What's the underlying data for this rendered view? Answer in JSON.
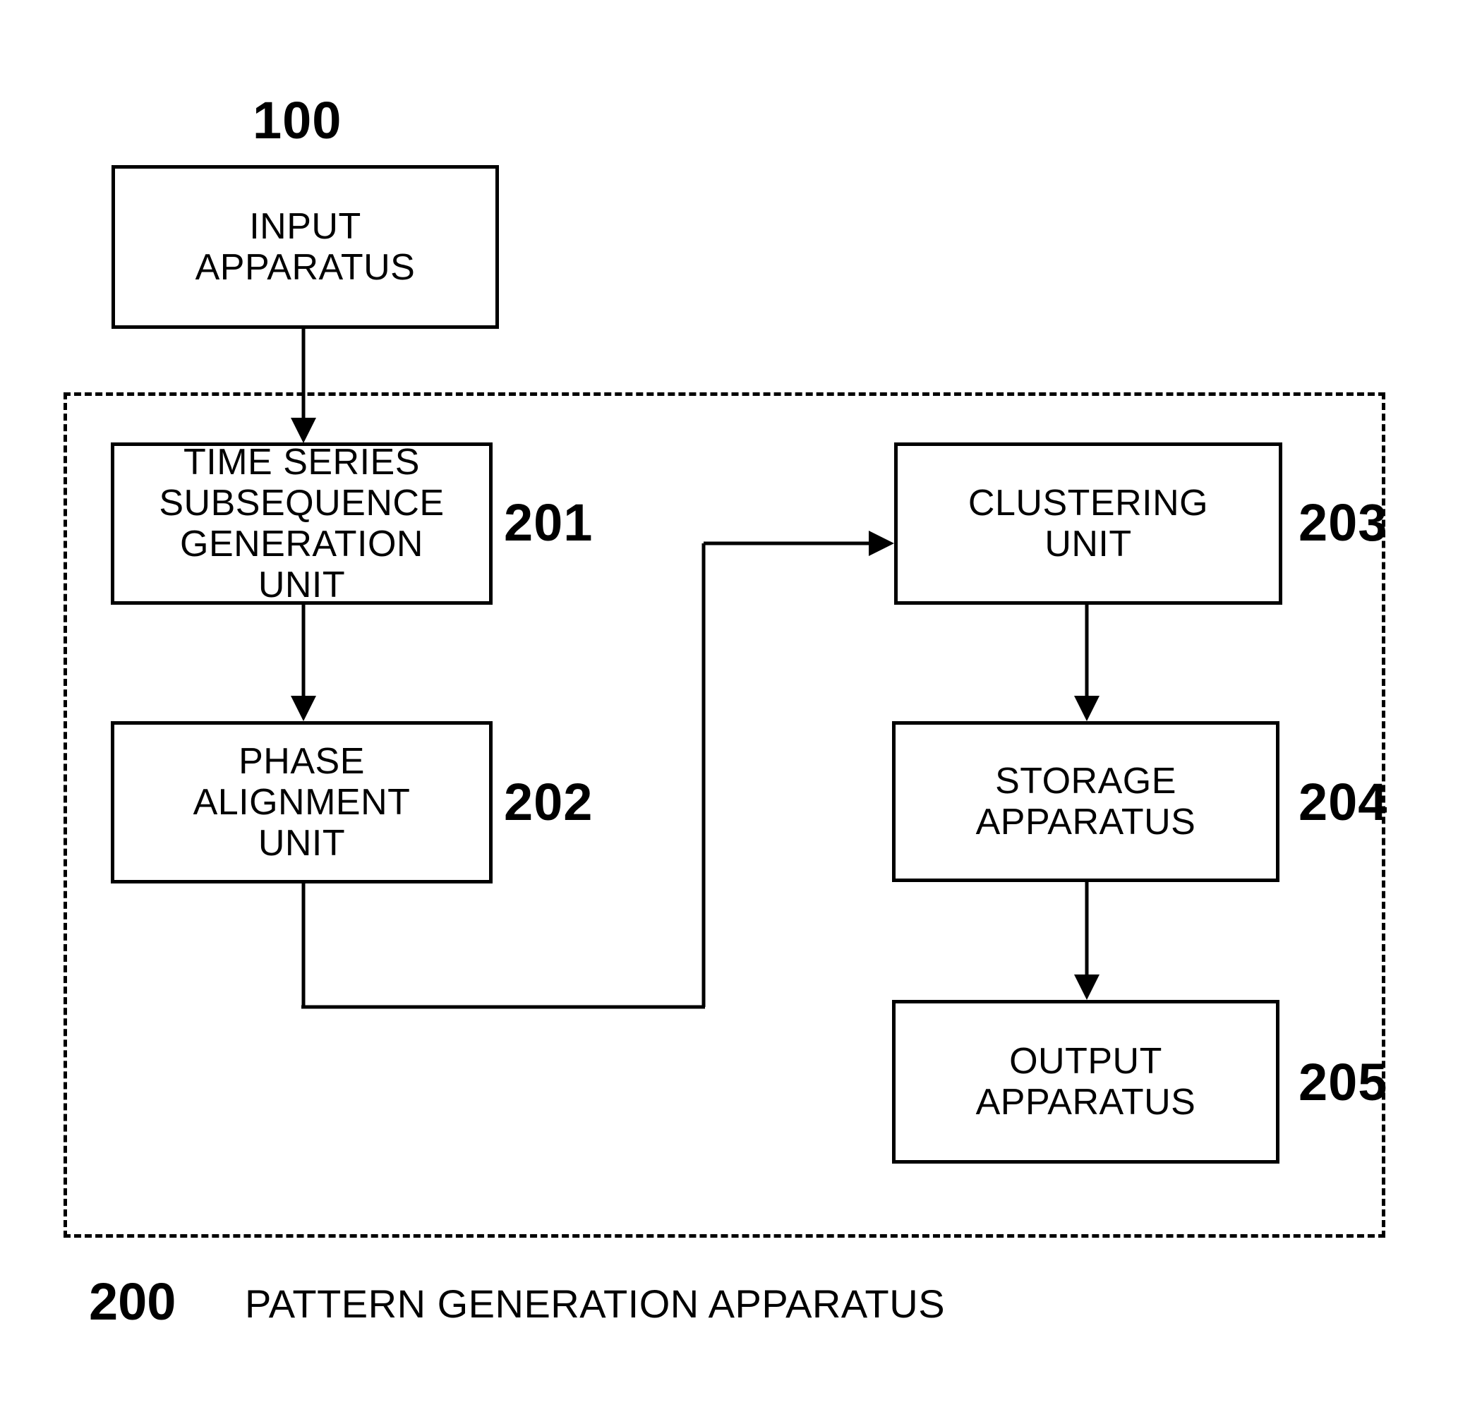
{
  "figure": {
    "type": "block-diagram",
    "background_color": "#ffffff",
    "line_color": "#000000"
  },
  "boxes": [
    {
      "id": "input-apparatus",
      "label": "INPUT\nAPPARATUS",
      "ref": "100",
      "ref_position": "above-right"
    },
    {
      "id": "time-series-subsequence-generation-unit",
      "label": "TIME SERIES\nSUBSEQUENCE\nGENERATION\nUNIT",
      "ref": "201",
      "ref_position": "right"
    },
    {
      "id": "phase-alignment-unit",
      "label": "PHASE\nALIGNMENT\nUNIT",
      "ref": "202",
      "ref_position": "right"
    },
    {
      "id": "clustering-unit",
      "label": "CLUSTERING\nUNIT",
      "ref": "203",
      "ref_position": "right"
    },
    {
      "id": "storage-apparatus",
      "label": "STORAGE\nAPPARATUS",
      "ref": "204",
      "ref_position": "right"
    },
    {
      "id": "output-apparatus",
      "label": "OUTPUT\nAPPARATUS",
      "ref": "205",
      "ref_position": "right"
    }
  ],
  "enclosure": {
    "id": "pattern-generation-apparatus",
    "style": "dashed",
    "ref": "200",
    "caption": "PATTERN GENERATION APPARATUS"
  },
  "connectors": [
    {
      "id": "input-to-generation",
      "from": "input-apparatus",
      "to": "time-series-subsequence-generation-unit",
      "arrow": "down"
    },
    {
      "id": "generation-to-phase",
      "from": "time-series-subsequence-generation-unit",
      "to": "phase-alignment-unit",
      "arrow": "down"
    },
    {
      "id": "phase-to-clustering",
      "from": "phase-alignment-unit",
      "to": "clustering-unit",
      "arrow": "right"
    },
    {
      "id": "clustering-to-storage",
      "from": "clustering-unit",
      "to": "storage-apparatus",
      "arrow": "down"
    },
    {
      "id": "storage-to-output",
      "from": "storage-apparatus",
      "to": "output-apparatus",
      "arrow": "down"
    }
  ],
  "refs": {
    "r100": "100",
    "r200": "200",
    "r201": "201",
    "r202": "202",
    "r203": "203",
    "r204": "204",
    "r205": "205"
  },
  "labels": {
    "input_apparatus": "INPUT\nAPPARATUS",
    "generation_unit": "TIME SERIES\nSUBSEQUENCE\nGENERATION\nUNIT",
    "phase_alignment_unit": "PHASE\nALIGNMENT\nUNIT",
    "clustering_unit": "CLUSTERING\nUNIT",
    "storage_apparatus": "STORAGE\nAPPARATUS",
    "output_apparatus": "OUTPUT\nAPPARATUS",
    "caption": "PATTERN GENERATION APPARATUS"
  }
}
